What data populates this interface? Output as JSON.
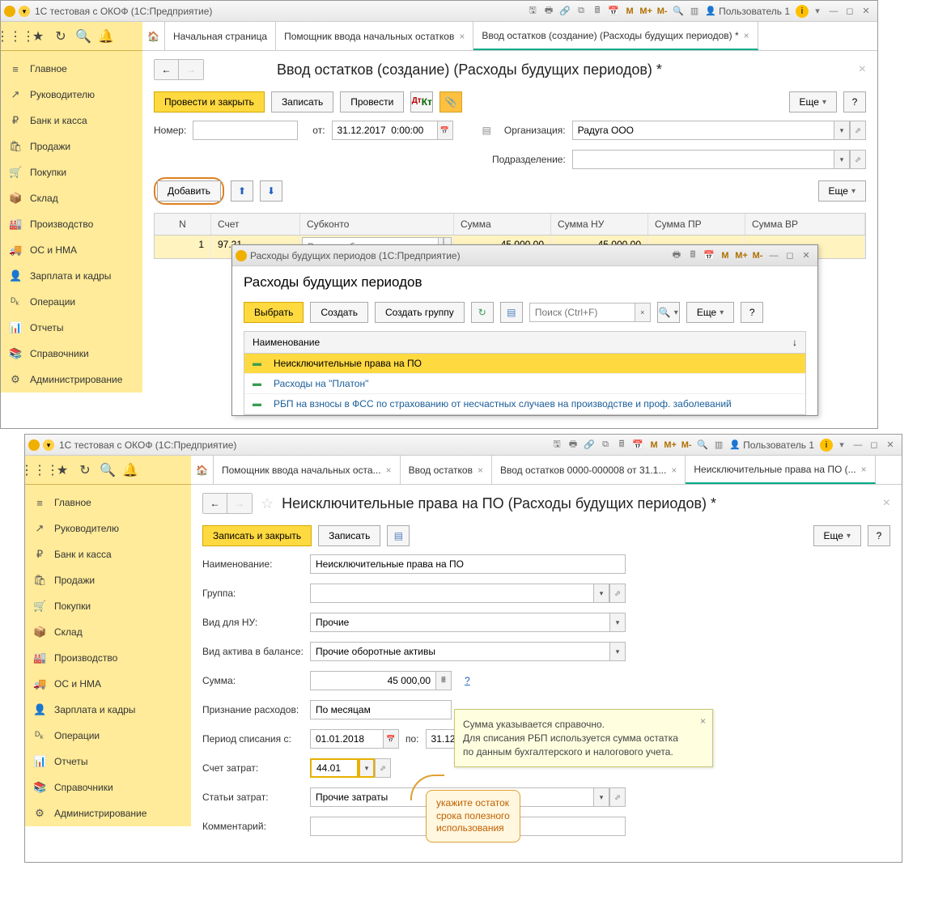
{
  "win1": {
    "title": "1С тестовая с ОКОФ  (1С:Предприятие)",
    "user": "Пользователь 1",
    "tabs": {
      "start": "Начальная страница",
      "helper": "Помощник ввода начальных остатков",
      "entry": "Ввод остатков (создание) (Расходы будущих периодов) *"
    },
    "page_title": "Ввод остатков (создание) (Расходы будущих периодов) *",
    "buttons": {
      "post_close": "Провести и закрыть",
      "record": "Записать",
      "post": "Провести",
      "more": "Еще",
      "help": "?",
      "add": "Добавить"
    },
    "form": {
      "number_label": "Номер:",
      "from_label": "от:",
      "date": "31.12.2017  0:00:00",
      "org_label": "Организация:",
      "org_value": "Радуга ООО",
      "dept_label": "Подразделение:"
    },
    "table": {
      "h_n": "N",
      "h_acct": "Счет",
      "h_sub": "Субконто",
      "h_sum": "Сумма",
      "h_sumnu": "Сумма НУ",
      "h_sumpr": "Сумма ПР",
      "h_sumvr": "Сумма ВР",
      "r_n": "1",
      "r_acct": "97.21",
      "r_sub_placeholder": "Расходы будущих ...",
      "r_sum": "45 000,00",
      "r_sumnu": "45 000,00"
    }
  },
  "sidebar": [
    {
      "icon": "≡",
      "label": "Главное"
    },
    {
      "icon": "↗",
      "label": "Руководителю"
    },
    {
      "icon": "₽",
      "label": "Банк и касса"
    },
    {
      "icon": "🛍",
      "label": "Продажи"
    },
    {
      "icon": "🛒",
      "label": "Покупки"
    },
    {
      "icon": "📦",
      "label": "Склад"
    },
    {
      "icon": "🏭",
      "label": "Производство"
    },
    {
      "icon": "🚚",
      "label": "ОС и НМА"
    },
    {
      "icon": "👤",
      "label": "Зарплата и кадры"
    },
    {
      "icon": "ᴰₖ",
      "label": "Операции"
    },
    {
      "icon": "📊",
      "label": "Отчеты"
    },
    {
      "icon": "📚",
      "label": "Справочники"
    },
    {
      "icon": "⚙",
      "label": "Администрирование"
    }
  ],
  "modal": {
    "title": "Расходы будущих периодов  (1С:Предприятие)",
    "heading": "Расходы будущих периодов",
    "btn_select": "Выбрать",
    "btn_create": "Создать",
    "btn_group": "Создать группу",
    "search_ph": "Поиск (Ctrl+F)",
    "more": "Еще",
    "help": "?",
    "col_name": "Наименование",
    "items": [
      "Неисключительные права на ПО",
      "Расходы на \"Платон\"",
      "РБП на взносы в ФСС по страхованию от несчастных случаев на производстве и проф. заболеваний"
    ]
  },
  "win2": {
    "title": "1С тестовая с ОКОФ  (1С:Предприятие)",
    "user": "Пользователь 1",
    "tabs": {
      "helper": "Помощник ввода начальных оста...",
      "entry": "Ввод остатков",
      "entry2": "Ввод остатков 0000-000008 от 31.1...",
      "rights": "Неисключительные права на ПО (..."
    },
    "page_title": "Неисключительные права на ПО (Расходы будущих периодов) *",
    "buttons": {
      "save_close": "Записать и закрыть",
      "record": "Записать",
      "more": "Еще",
      "help": "?"
    },
    "form": {
      "name_label": "Наименование:",
      "name_value": "Неисключительные права на ПО",
      "group_label": "Группа:",
      "vidnu_label": "Вид для НУ:",
      "vidnu_value": "Прочие",
      "asset_label": "Вид актива в балансе:",
      "asset_value": "Прочие оборотные активы",
      "sum_label": "Сумма:",
      "sum_value": "45 000,00",
      "sum_help": "?",
      "recog_label": "Признание расходов:",
      "recog_value": "По месяцам",
      "period_label": "Период списания с:",
      "period_from": "01.01.2018",
      "period_to_label": "по:",
      "period_to": "31.12",
      "acct_label": "Счет затрат:",
      "acct_value": "44.01",
      "article_label": "Статьи затрат:",
      "article_value": "Прочие затраты",
      "comment_label": "Комментарий:"
    }
  },
  "tooltip": {
    "l1": "Сумма указывается справочно.",
    "l2": "Для списания РБП используется сумма остатка",
    "l3": "по данным бухгалтерского и налогового учета."
  },
  "callout": {
    "l1": "укажите остаток",
    "l2": "срока полезного",
    "l3": "использования"
  }
}
